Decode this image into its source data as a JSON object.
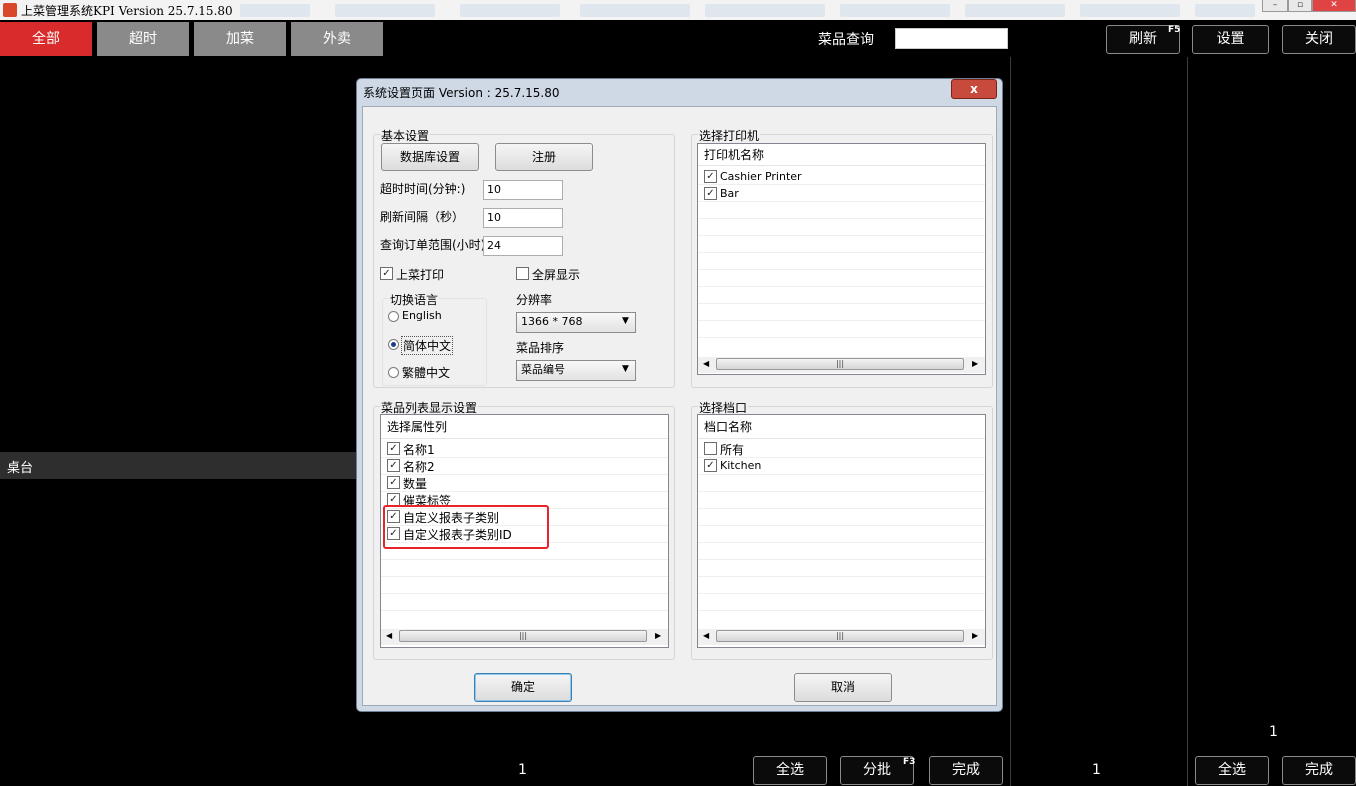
{
  "window": {
    "title": "上菜管理系统KPI Version 25.7.15.80",
    "controls": [
      "–",
      "▫",
      "✕"
    ]
  },
  "tabs": [
    {
      "label": "全部",
      "active": true
    },
    {
      "label": "超时",
      "active": false
    },
    {
      "label": "加菜",
      "active": false
    },
    {
      "label": "外卖",
      "active": false
    }
  ],
  "search": {
    "label": "菜品查询",
    "value": ""
  },
  "top_buttons": {
    "refresh": "刷新",
    "refresh_key": "F5",
    "settings": "设置",
    "close": "关闭"
  },
  "left_panel": {
    "table_label": "桌台",
    "page": "1"
  },
  "mid_panel": {
    "page": "1"
  },
  "right_panel": {
    "page_top": "1"
  },
  "bottom_buttons": {
    "select_all": "全选",
    "split": "分批",
    "split_key": "F3",
    "done": "完成",
    "select_all_2": "全选",
    "done_2": "完成"
  },
  "dialog": {
    "title": "系统设置页面    Version : 25.7.15.80",
    "close_glyph": "x",
    "basic": {
      "group_label": "基本设置",
      "db_button": "数据库设置",
      "register_button": "注册",
      "timeout_label": "超时时间(分钟:)",
      "timeout_value": "10",
      "refresh_label": "刷新间隔（秒）",
      "refresh_value": "10",
      "query_label": "查询订单范围(小时)",
      "query_value": "24",
      "print_label": "上菜打印",
      "print_checked": true,
      "fullscreen_label": "全屏显示",
      "fullscreen_checked": false,
      "language_label": "切换语言",
      "languages": [
        {
          "label": "English",
          "selected": false
        },
        {
          "label": "简体中文",
          "selected": true
        },
        {
          "label": "繁體中文",
          "selected": false
        }
      ],
      "resolution_label": "分辨率",
      "resolution_value": "1366 * 768",
      "sort_label": "菜品排序",
      "sort_value": "菜品编号"
    },
    "printer": {
      "group_label": "选择打印机",
      "header": "打印机名称",
      "items": [
        {
          "label": "Cashier Printer",
          "checked": true
        },
        {
          "label": "Bar",
          "checked": true
        }
      ]
    },
    "columns": {
      "group_label": "菜品列表显示设置",
      "header": "选择属性列",
      "items": [
        {
          "label": "名称1",
          "checked": true
        },
        {
          "label": "名称2",
          "checked": true
        },
        {
          "label": "数量",
          "checked": true
        },
        {
          "label": "催菜标签",
          "checked": true
        },
        {
          "label": "自定义报表子类别",
          "checked": true
        },
        {
          "label": "自定义报表子类别ID",
          "checked": true
        }
      ]
    },
    "stations": {
      "group_label": "选择档口",
      "header": "档口名称",
      "items": [
        {
          "label": "所有",
          "checked": false
        },
        {
          "label": "Kitchen",
          "checked": true
        }
      ]
    },
    "ok_button": "确定",
    "cancel_button": "取消"
  },
  "colors": {
    "accent_red": "#d92b2b",
    "highlight": "#e8242b",
    "dialog_frame": "#cfd9e6"
  }
}
